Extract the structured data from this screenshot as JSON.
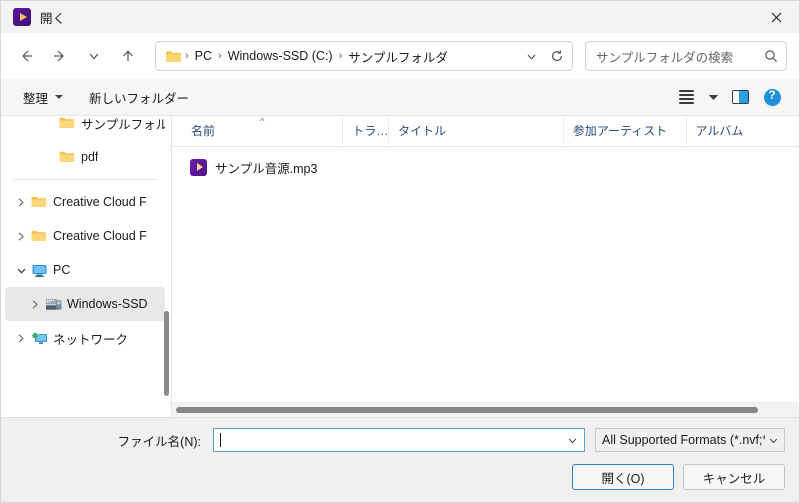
{
  "window": {
    "title": "開く",
    "app_icon": "media-player-icon",
    "close_label": "✕"
  },
  "nav": {
    "back": "back-arrow",
    "forward": "forward-arrow",
    "recent": "chevron-down",
    "up": "up-arrow"
  },
  "address": {
    "folder_icon": "folder-icon",
    "crumbs": [
      "PC",
      "Windows-SSD (C:)",
      "サンプルフォルダ"
    ],
    "separator": "›",
    "dropdown_icon": "chevron-down-icon",
    "refresh_icon": "refresh-icon"
  },
  "search": {
    "placeholder": "サンプルフォルダの検索",
    "icon": "search-icon"
  },
  "commandbar": {
    "organize_label": "整理",
    "new_folder_label": "新しいフォルダー",
    "view_icon": "view-list-icon",
    "view_dropdown_icon": "chevron-down-icon",
    "preview_pane_icon": "preview-pane-icon",
    "help_icon": "help-icon",
    "help_glyph": "?"
  },
  "sidebar": {
    "items": [
      {
        "label": "サンプルフォルダ",
        "icon": "folder-icon",
        "expander": "none",
        "indent": 2,
        "selected": false
      },
      {
        "label": "pdf",
        "icon": "folder-icon",
        "expander": "none",
        "indent": 2,
        "selected": false
      },
      {
        "label": "Creative Cloud F",
        "icon": "folder-icon",
        "expander": "collapsed",
        "indent": 0,
        "selected": false
      },
      {
        "label": "Creative Cloud F",
        "icon": "folder-icon",
        "expander": "collapsed",
        "indent": 0,
        "selected": false
      },
      {
        "label": "PC",
        "icon": "pc-icon",
        "expander": "expanded",
        "indent": 0,
        "selected": false
      },
      {
        "label": "Windows-SSD",
        "icon": "drive-icon",
        "expander": "collapsed",
        "indent": 1,
        "selected": true
      },
      {
        "label": "ネットワーク",
        "icon": "network-icon",
        "expander": "collapsed",
        "indent": 0,
        "selected": false
      }
    ]
  },
  "filelist": {
    "columns": [
      {
        "label": "名前",
        "sort": "ascending"
      },
      {
        "label": "トラ…",
        "sort": "none"
      },
      {
        "label": "タイトル",
        "sort": "none"
      },
      {
        "label": "参加アーティスト",
        "sort": "none"
      },
      {
        "label": "アルバム",
        "sort": "none"
      }
    ],
    "rows": [
      {
        "name": "サンプル音源.mp3",
        "icon": "media-file-icon",
        "track": "",
        "title": "",
        "artist": "",
        "album": ""
      }
    ]
  },
  "footer": {
    "filename_label": "ファイル名(N):",
    "filename_value": "",
    "filetype_value": "All Supported Formats (*.nvf;*.h",
    "open_button": "開く(O)",
    "cancel_button": "キャンセル"
  },
  "colors": {
    "accent": "#2e7fc4",
    "titlebar_bg": "#f3f3f3",
    "footer_bg": "#f0f0f0",
    "column_header_text": "#2a4b7c",
    "selection_bg": "#e8e8e8"
  }
}
